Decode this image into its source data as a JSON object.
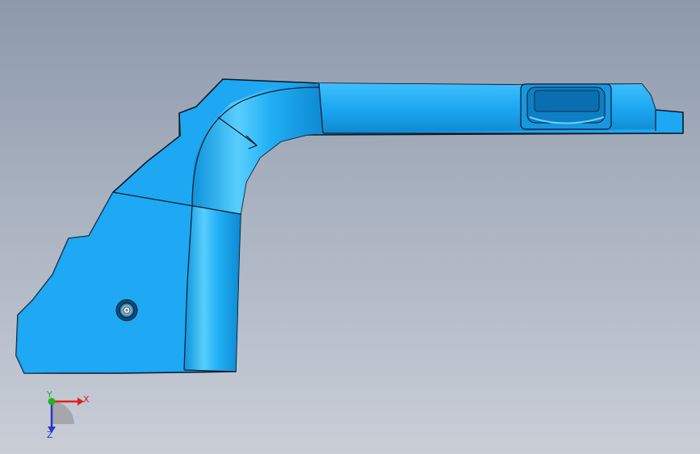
{
  "viewport": {
    "background_top": "#8d99aa",
    "background_bottom": "#c9ced7"
  },
  "part": {
    "fill": "#1ea7f2",
    "highlight": "#6fd6ff",
    "shade": "#0a86cf",
    "edge": "#0b1a2a"
  },
  "triad": {
    "x_label": "X",
    "y_label": "Y",
    "z_label": "Z",
    "x_color": "#e0211b",
    "y_color": "#1fb41f",
    "z_color": "#2a35c8"
  }
}
